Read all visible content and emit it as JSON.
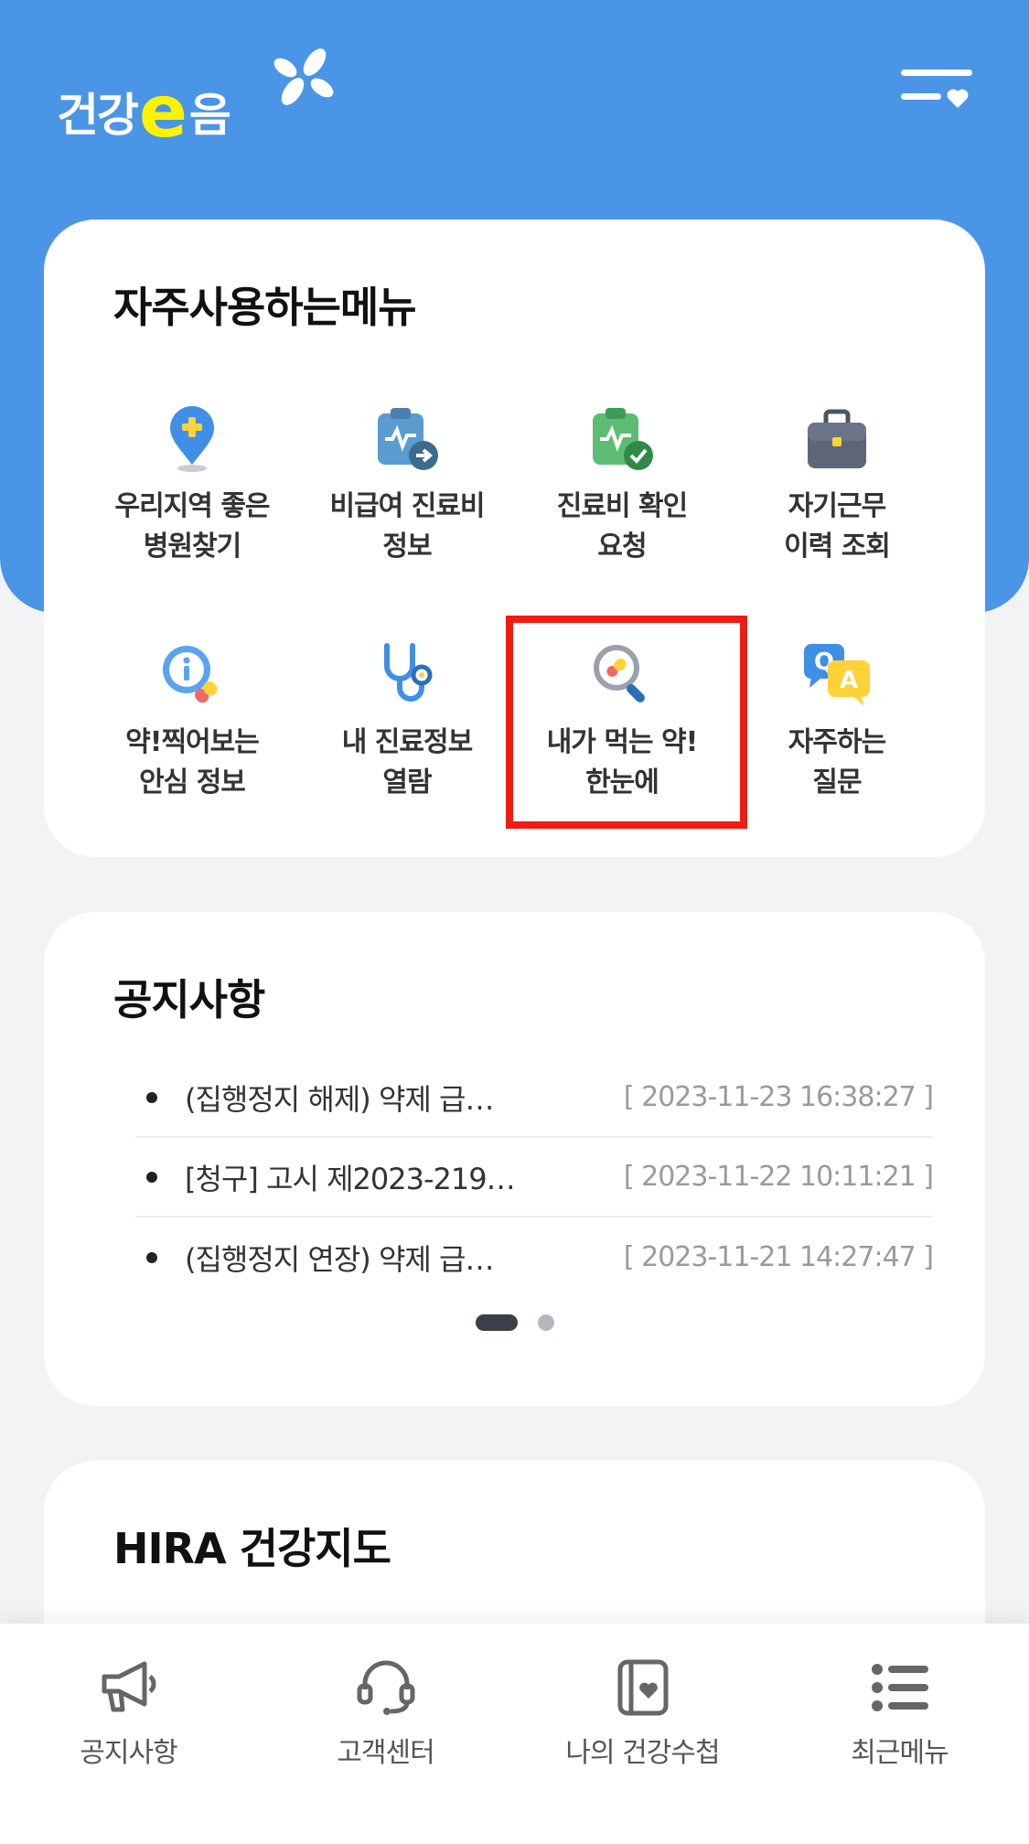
{
  "header": {
    "logo_text_1": "건강",
    "logo_e": "e",
    "logo_text_2": "음"
  },
  "frequent_menu": {
    "title": "자주사용하는메뉴",
    "items": [
      {
        "label": "우리지역 좋은\n병원찾기",
        "icon": "map-pin-plus-icon"
      },
      {
        "label": "비급여 진료비\n정보",
        "icon": "clipboard-arrow-icon"
      },
      {
        "label": "진료비 확인\n요청",
        "icon": "clipboard-check-icon"
      },
      {
        "label": "자기근무\n이력 조회",
        "icon": "briefcase-icon"
      },
      {
        "label": "약!찍어보는\n안심 정보",
        "icon": "info-pill-icon"
      },
      {
        "label": "내 진료정보\n열람",
        "icon": "stethoscope-icon"
      },
      {
        "label": "내가 먹는 약!\n한눈에",
        "icon": "magnifier-pill-icon"
      },
      {
        "label": "자주하는\n질문",
        "icon": "qa-bubble-icon"
      }
    ]
  },
  "notices": {
    "title": "공지사항",
    "items": [
      {
        "title": "(집행정지 해제) 약제 급…",
        "date": "[ 2023-11-23 16:38:27 ]"
      },
      {
        "title": "[청구] 고시 제2023-219…",
        "date": "[ 2023-11-22 10:11:21 ]"
      },
      {
        "title": "(집행정지 연장) 약제 급…",
        "date": "[ 2023-11-21 14:27:47 ]"
      }
    ],
    "page_current": 1,
    "page_total": 2
  },
  "health_map": {
    "title": "HIRA 건강지도"
  },
  "bottom_nav": [
    {
      "label": "공지사항",
      "icon": "megaphone-icon"
    },
    {
      "label": "고객센터",
      "icon": "headset-icon"
    },
    {
      "label": "나의 건강수첩",
      "icon": "health-notebook-icon"
    },
    {
      "label": "최근메뉴",
      "icon": "list-icon"
    }
  ],
  "colors": {
    "header_blue": "#4a95e6",
    "logo_yellow": "#fff200",
    "highlight_red": "#ee1c12"
  }
}
